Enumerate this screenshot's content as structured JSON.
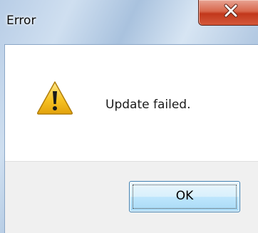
{
  "window": {
    "title": "Error"
  },
  "dialog": {
    "message": "Update failed.",
    "icon": "warning-icon",
    "buttons": {
      "ok_label": "OK"
    }
  },
  "colors": {
    "close_button": "#c7462a",
    "content_background": "#ffffff",
    "footer_background": "#f0f0f0",
    "warning_yellow": "#f7c325",
    "button_border": "#3c7fb1"
  }
}
